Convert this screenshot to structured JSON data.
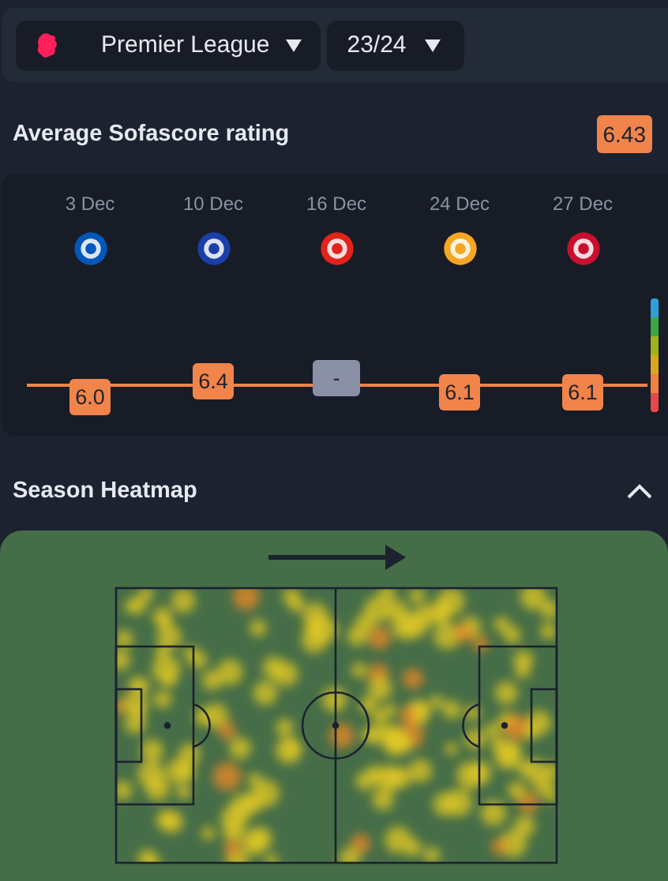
{
  "filters": {
    "league": "Premier League",
    "season": "23/24"
  },
  "rating_section": {
    "title": "Average Sofascore rating",
    "average": "6.43",
    "matches": [
      {
        "date": "3 Dec",
        "color": "#0057b8",
        "rating": "6.0",
        "kind": "rated"
      },
      {
        "date": "10 Dec",
        "color": "#1b3fa8",
        "rating": "6.4",
        "kind": "rated"
      },
      {
        "date": "16 Dec",
        "color": "#e2231a",
        "rating": "-",
        "kind": "unrated"
      },
      {
        "date": "24 Dec",
        "color": "#f5a623",
        "rating": "6.1",
        "kind": "rated"
      },
      {
        "date": "27 Dec",
        "color": "#c8102e",
        "rating": "6.1",
        "kind": "rated"
      }
    ]
  },
  "heatmap_section": {
    "title": "Season Heatmap",
    "expanded": true
  }
}
